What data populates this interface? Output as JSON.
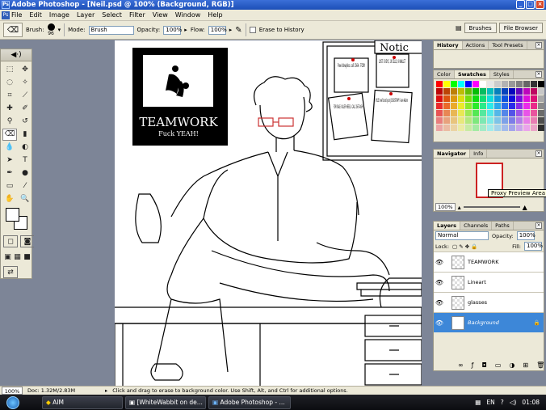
{
  "window": {
    "title": "Adobe Photoshop - [Neil.psd @ 100% (Background, RGB)]"
  },
  "menu": [
    "File",
    "Edit",
    "Image",
    "Layer",
    "Select",
    "Filter",
    "View",
    "Window",
    "Help"
  ],
  "options": {
    "brush_label": "Brush:",
    "brush_size": "96",
    "mode_label": "Mode:",
    "mode_value": "Brush",
    "opacity_label": "Opacity:",
    "opacity_value": "100%",
    "flow_label": "Flow:",
    "flow_value": "100%",
    "erase_history": "Erase to History"
  },
  "wells": [
    "Brushes",
    "File Browser"
  ],
  "history_panel": {
    "tabs": [
      "History",
      "Actions",
      "Tool Presets"
    ]
  },
  "color_panel": {
    "tabs": [
      "Color",
      "Swatches",
      "Styles"
    ]
  },
  "navigator_panel": {
    "tabs": [
      "Navigator",
      "Info"
    ],
    "zoom": "100%"
  },
  "tooltip": "Proxy Preview Area",
  "layers_panel": {
    "tabs": [
      "Layers",
      "Channels",
      "Paths"
    ],
    "blend_mode": "Normal",
    "opacity_label": "Opacity:",
    "opacity": "100%",
    "lock_label": "Lock:",
    "fill_label": "Fill:",
    "fill": "100%",
    "layers": [
      {
        "name": "TEAMWORK",
        "selected": false
      },
      {
        "name": "Lineart",
        "selected": false
      },
      {
        "name": "glasses",
        "selected": false
      },
      {
        "name": "Background",
        "selected": true
      }
    ]
  },
  "canvas": {
    "poster_title": "TEAMWORK",
    "poster_subtitle": "Fuck YEAH!",
    "board_title": "Notic",
    "notes": [
      "Free blowjobs. call 1564. -TOBY",
      "LOST: 5 KEYS, 10 CELLS, 9 WALLET",
      "FOR SALE: KILLER HEELS. CALL 1567-ASH",
      "KYLE! we found your JOCK-STRAP! -love Adam"
    ]
  },
  "status": {
    "zoom": "100%",
    "doc": "Doc: 1.32M/2.83M",
    "hint": "Click and drag to erase to background color. Use Shift, Alt, and Ctrl for additional options."
  },
  "taskbar": {
    "tasks": [
      "AIM",
      "[WhiteWabbit on de...",
      "Adobe Photoshop - ..."
    ],
    "lang": "EN",
    "time": "01:08"
  },
  "colors": {
    "selection": "#3d87d8",
    "titlebar": "#1c4fb7",
    "workspace": "#7d8597"
  },
  "swatch_palette": [
    "#ff0000",
    "#ffff00",
    "#00ff00",
    "#00ffff",
    "#0000ff",
    "#ff00ff",
    "#ffffff",
    "#e6e6e6",
    "#cccccc",
    "#b3b3b3",
    "#999999",
    "#808080",
    "#666666",
    "#333333",
    "#000000"
  ]
}
